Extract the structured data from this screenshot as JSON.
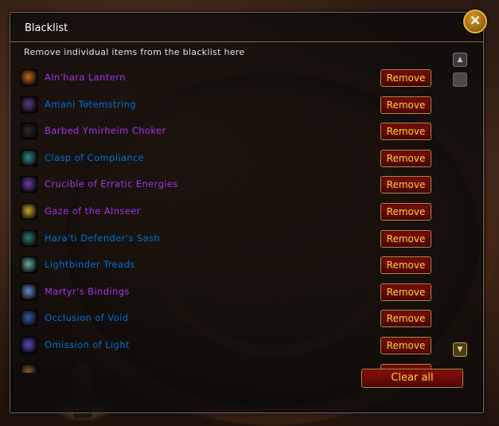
{
  "window": {
    "title": "Blacklist",
    "subtitle": "Remove individual items from the blacklist here",
    "close_icon": "×"
  },
  "items": [
    {
      "name": "Aln'hara Lantern",
      "color": "#a335ee",
      "icon": "lantern-icon",
      "icon_color": "#c8631a",
      "remove_label": "Remove"
    },
    {
      "name": "Amani Totemstring",
      "color": "#0070dd",
      "icon": "totemstring-icon",
      "icon_color": "#5b3a7a",
      "remove_label": "Remove"
    },
    {
      "name": "Barbed Ymirheim Choker",
      "color": "#a335ee",
      "icon": "choker-icon",
      "icon_color": "#2a2a2a",
      "remove_label": "Remove"
    },
    {
      "name": "Clasp of Compliance",
      "color": "#0070dd",
      "icon": "clasp-icon",
      "icon_color": "#2f8a8a",
      "remove_label": "Remove"
    },
    {
      "name": "Crucible of Erratic Energies",
      "color": "#a335ee",
      "icon": "crucible-icon",
      "icon_color": "#6a3aa8",
      "remove_label": "Remove"
    },
    {
      "name": "Gaze of the Alnseer",
      "color": "#a335ee",
      "icon": "gaze-icon",
      "icon_color": "#c9a42a",
      "remove_label": "Remove"
    },
    {
      "name": "Hara'ti Defender's Sash",
      "color": "#0070dd",
      "icon": "sash-icon",
      "icon_color": "#2a7a6a",
      "remove_label": "Remove"
    },
    {
      "name": "Lightbinder Treads",
      "color": "#0070dd",
      "icon": "treads-icon",
      "icon_color": "#6aa8a0",
      "remove_label": "Remove"
    },
    {
      "name": "Martyr's Bindings",
      "color": "#a335ee",
      "icon": "bindings-icon",
      "icon_color": "#6a8ac8",
      "remove_label": "Remove"
    },
    {
      "name": "Occlusion of Void",
      "color": "#0070dd",
      "icon": "void-icon",
      "icon_color": "#3a5aa8",
      "remove_label": "Remove"
    },
    {
      "name": "Omission of Light",
      "color": "#0070dd",
      "icon": "light-icon",
      "icon_color": "#5a4ab8",
      "remove_label": "Remove"
    },
    {
      "name": "",
      "color": "#a335ee",
      "icon": "partial-item-icon",
      "icon_color": "#8a5a2a",
      "remove_label": "Remove"
    }
  ],
  "footer": {
    "clear_all_label": "Clear all"
  }
}
